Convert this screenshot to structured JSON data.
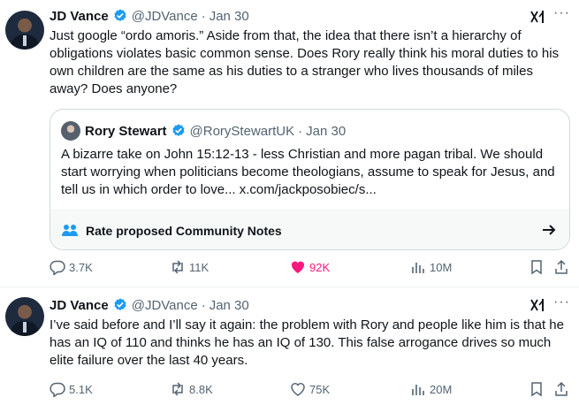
{
  "colors": {
    "text": "#0f1419",
    "muted": "#536471",
    "verified": "#1d9bf0",
    "like_active": "#f91880",
    "border": "#cfd9de"
  },
  "tweets": [
    {
      "author_name": "JD Vance",
      "handle": "@JDVance",
      "separator": "·",
      "date": "Jan 30",
      "more": "···",
      "text": "Just google “ordo amoris.” Aside from that, the idea that there isn’t a hierarchy of obligations violates basic common sense. Does Rory really think his moral duties to his own children are the same as his duties to a stranger who lives thousands of miles away? Does anyone?",
      "quote": {
        "author_name": "Rory Stewart",
        "handle": "@RoryStewartUK",
        "separator": "·",
        "date": "Jan 30",
        "text": "A bizarre take on John 15:12-13  - less Christian and more pagan tribal. We should start worrying when politicians become theologians, assume to speak for Jesus, and tell us in which order to love... x.com/jackposobiec/s...",
        "community_notes_label": "Rate proposed Community Notes"
      },
      "stats": {
        "replies": "3.7K",
        "reposts": "11K",
        "likes": "92K",
        "views": "10M"
      },
      "liked": true
    },
    {
      "author_name": "JD Vance",
      "handle": "@JDVance",
      "separator": "·",
      "date": "Jan 30",
      "more": "···",
      "text": "I’ve said before and I’ll say it again: the problem with Rory and people like him is that he has an IQ of 110 and thinks he has an IQ of 130.  This false arrogance drives so much elite failure over the last 40 years.",
      "stats": {
        "replies": "5.1K",
        "reposts": "8.8K",
        "likes": "75K",
        "views": "20M"
      },
      "liked": false
    }
  ]
}
